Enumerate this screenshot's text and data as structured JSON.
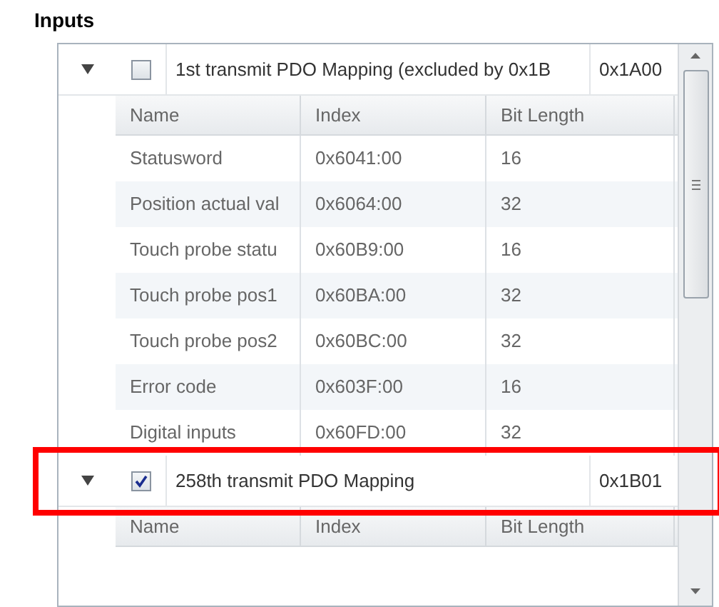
{
  "section_title": "Inputs",
  "groups": [
    {
      "title": "1st transmit PDO Mapping (excluded by 0x1B",
      "index": "0x1A00",
      "checked": false,
      "expanded": true,
      "highlighted": false,
      "columns": [
        "Name",
        "Index",
        "Bit Length"
      ],
      "rows": [
        [
          "Statusword",
          "0x6041:00",
          "16"
        ],
        [
          "Position actual val",
          "0x6064:00",
          "32"
        ],
        [
          "Touch probe statu",
          "0x60B9:00",
          "16"
        ],
        [
          "Touch probe pos1",
          "0x60BA:00",
          "32"
        ],
        [
          "Touch probe pos2",
          "0x60BC:00",
          "32"
        ],
        [
          "Error code",
          "0x603F:00",
          "16"
        ],
        [
          "Digital inputs",
          "0x60FD:00",
          "32"
        ]
      ]
    },
    {
      "title": "258th transmit PDO Mapping",
      "index": "0x1B01",
      "checked": true,
      "expanded": true,
      "highlighted": true,
      "columns": [
        "Name",
        "Index",
        "Bit Length"
      ]
    }
  ]
}
